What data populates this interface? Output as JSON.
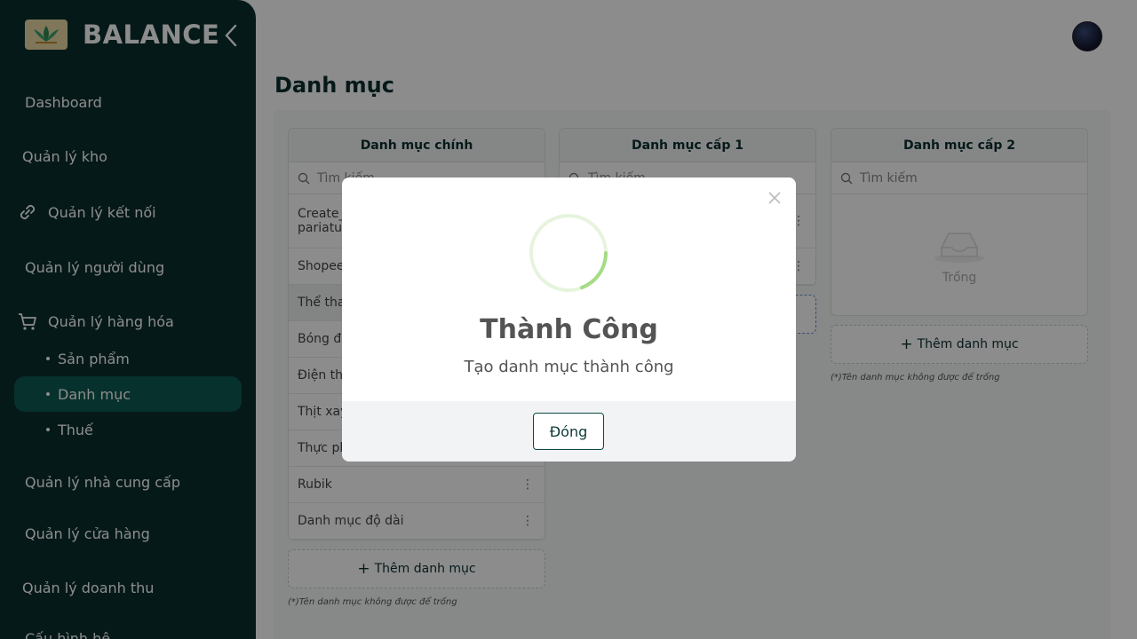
{
  "sidebar": {
    "brand": "BALANCE",
    "items": [
      {
        "label": "Dashboard"
      },
      {
        "label": "Quản lý kho"
      },
      {
        "label": "Quản lý kết nối"
      },
      {
        "label": "Quản lý người dùng"
      },
      {
        "label": "Quản lý hàng hóa"
      },
      {
        "label": "Quản lý nhà cung cấp"
      },
      {
        "label": "Quản lý cửa hàng"
      },
      {
        "label": "Quản lý doanh thu"
      },
      {
        "label": "Cấu hình hệ"
      }
    ],
    "sub_items": [
      {
        "label": "Sản phẩm"
      },
      {
        "label": "Danh mục",
        "active": true
      },
      {
        "label": "Thuế"
      }
    ]
  },
  "page": {
    "title": "Danh mục"
  },
  "columns": {
    "main": {
      "title": "Danh mục chính",
      "search_placeholder": "Tìm kiếm",
      "rows": [
        {
          "label": "Create_\npariatu"
        },
        {
          "label": "Shopee"
        },
        {
          "label": "Thể tha"
        },
        {
          "label": "Bóng đ"
        },
        {
          "label": "Điện th"
        },
        {
          "label": "Thịt xay"
        },
        {
          "label": "Thực ph"
        },
        {
          "label": "Rubik"
        },
        {
          "label": "Danh mục độ dài"
        }
      ],
      "add_label": "Thêm danh mục",
      "hint": "(*)Tên danh mục không được để trống"
    },
    "level1": {
      "title": "Danh mục cấp 1",
      "search_placeholder": "Tìm kiếm"
    },
    "level2": {
      "title": "Danh mục cấp 2",
      "search_placeholder": "Tìm kiếm",
      "empty_text": "Trống",
      "add_label": "Thêm danh mục",
      "hint": "(*)Tên danh mục không được để trống"
    }
  },
  "modal": {
    "title": "Thành Công",
    "message": "Tạo danh mục thành công",
    "close_label": "Đóng"
  },
  "colors": {
    "sidebar_bg": "#0c2f2f",
    "active_item": "#0e5a50",
    "spinner_accent": "#a5dc86"
  }
}
